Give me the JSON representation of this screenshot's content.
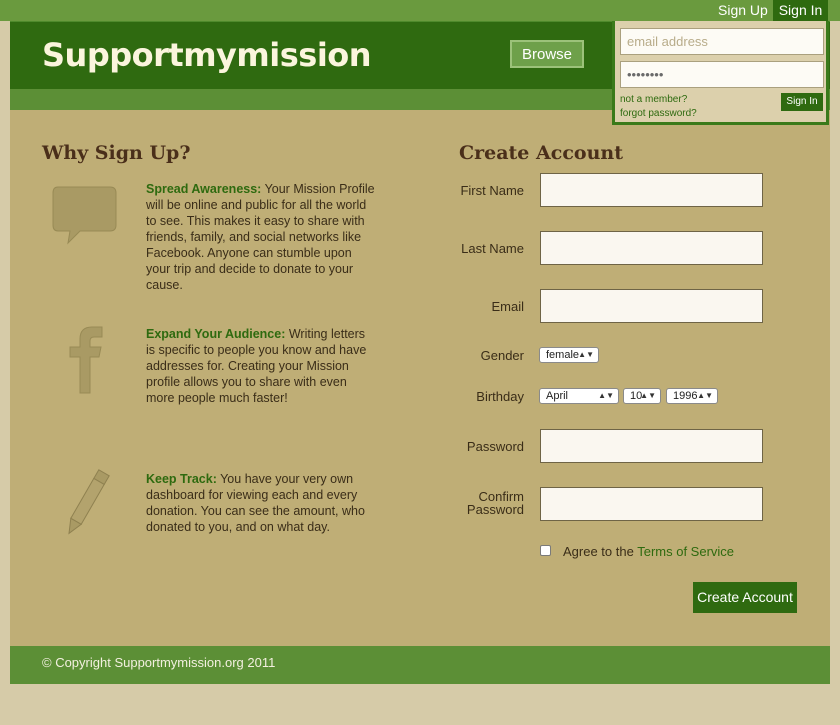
{
  "nav": {
    "signup": "Sign Up",
    "signin": "Sign In",
    "browse": "Browse"
  },
  "logo": "Supportmymission",
  "login": {
    "email_placeholder": "email address",
    "password_masked": "••••••••",
    "not_member": "not a member?",
    "forgot": "forgot password?",
    "signin_button": "Sign In"
  },
  "why": {
    "title": "Why Sign Up?",
    "features": [
      {
        "icon": "speech-bubble-icon",
        "title": "Spread Awareness:",
        "text": " Your Mission Profile will be online and public for all the world to see. This makes it easy to share with friends, family, and social networks like Facebook. Anyone can stumble upon your trip and decide to donate to your cause."
      },
      {
        "icon": "facebook-icon",
        "title": "Expand Your Audience:",
        "text": " Writing letters is specific to people you know and have addresses for. Creating your Mission profile allows you to share with even more people much faster!"
      },
      {
        "icon": "pencil-icon",
        "title": "Keep Track:",
        "text": " You have your very own dashboard for viewing each and every donation. You can see the amount, who donated to you, and on what day."
      }
    ]
  },
  "form": {
    "title": "Create Account",
    "first_name": "First Name",
    "last_name": "Last Name",
    "email": "Email",
    "gender": "Gender",
    "gender_value": "female",
    "birthday": "Birthday",
    "birth_month": "April",
    "birth_day": "10",
    "birth_year": "1996",
    "password": "Password",
    "confirm_line1": "Confirm",
    "confirm_line2": "Password",
    "agree": "Agree to the ",
    "tos": "Terms of Service",
    "submit": "Create Account"
  },
  "footer": {
    "copyright": "© Copyright Supportmymission.org 2011"
  },
  "colors": {
    "brand_green": "#2f6a10",
    "accent_green": "#5c8f36",
    "panel_tan": "#bfae76",
    "page_bg": "#d6cba8"
  }
}
